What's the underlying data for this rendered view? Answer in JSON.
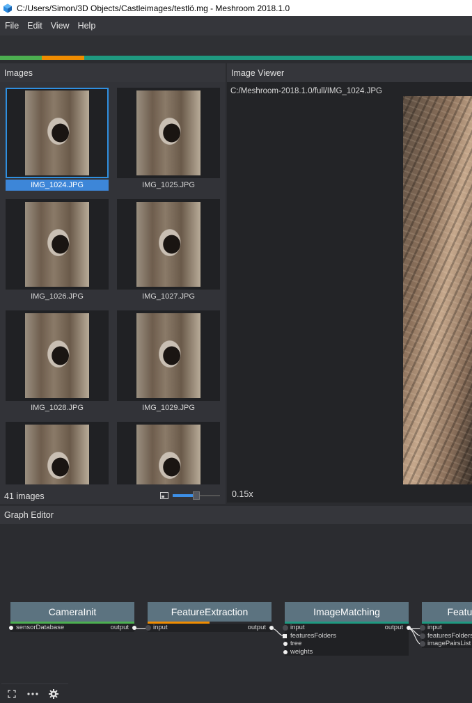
{
  "window": {
    "title": "C:/Users/Simon/3D Objects/Castleimages/testlö.mg - Meshroom 2018.1.0"
  },
  "menu": [
    {
      "label": "File"
    },
    {
      "label": "Edit"
    },
    {
      "label": "View"
    },
    {
      "label": "Help"
    }
  ],
  "progress": {
    "segments": [
      {
        "color": "#4caf50",
        "fraction": 0.088
      },
      {
        "color": "#f08c00",
        "fraction": 0.09
      },
      {
        "color": "#1f9980",
        "fraction": 0.822
      }
    ]
  },
  "images": {
    "header": "Images",
    "count_label": "41 images",
    "thumbnail_size": 0.5,
    "items": [
      {
        "name": "IMG_1024.JPG",
        "selected": true
      },
      {
        "name": "IMG_1025.JPG"
      },
      {
        "name": "IMG_1026.JPG"
      },
      {
        "name": "IMG_1027.JPG"
      },
      {
        "name": "IMG_1028.JPG"
      },
      {
        "name": "IMG_1029.JPG"
      },
      {
        "name": ""
      },
      {
        "name": ""
      }
    ]
  },
  "viewer": {
    "header": "Image Viewer",
    "path": "C:/Meshroom-2018.1.0/full/IMG_1024.JPG",
    "zoom": "0.15x"
  },
  "graph": {
    "header": "Graph Editor",
    "nodes": [
      {
        "title": "CameraInit",
        "status_color": "#4caf50",
        "status": 1.0,
        "inputs": [
          {
            "label": "sensorDatabase",
            "pin": "dot"
          }
        ],
        "output": "output"
      },
      {
        "title": "FeatureExtraction",
        "status_color": "#f08c00",
        "status": 0.5,
        "inputs": [
          {
            "label": "input",
            "pin": "dark"
          }
        ],
        "output": "output"
      },
      {
        "title": "ImageMatching",
        "status_color": "#1f9980",
        "status": 1.0,
        "inputs": [
          {
            "label": "input",
            "pin": "dark"
          },
          {
            "label": "featuresFolders",
            "pin": "square"
          },
          {
            "label": "tree",
            "pin": "dot"
          },
          {
            "label": "weights",
            "pin": "dot"
          }
        ],
        "output": "output"
      },
      {
        "title": "FeatureMatching",
        "status_color": "#1f9980",
        "status": 1.0,
        "inputs": [
          {
            "label": "input",
            "pin": "dark"
          },
          {
            "label": "featuresFolders",
            "pin": "dark"
          },
          {
            "label": "imagePairsList",
            "pin": "dark"
          }
        ],
        "output": ""
      }
    ]
  },
  "icons": {
    "fit": "fit-view-icon",
    "more": "more-icon",
    "settings": "gear-icon"
  }
}
